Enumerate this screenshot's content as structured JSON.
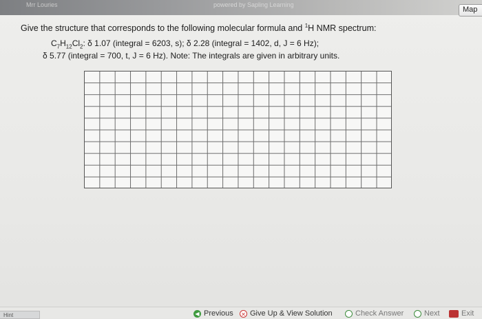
{
  "topbar": {
    "left_text": "Mrr Louries",
    "powered": "powered by Sapling Learning",
    "map_label": "Map"
  },
  "question": {
    "prompt_main": "Give the structure that corresponds to the following molecular formula and ",
    "prompt_sup": "1",
    "prompt_end": "H NMR spectrum:",
    "formula": "C7H12Cl2",
    "line1_rest": ": δ 1.07 (integral = 6203, s); δ 2.28 (integral = 1402, d, J = 6 Hz);",
    "line2": "δ 5.77 (integral = 700, t, J = 6 Hz). Note: The integrals are given in arbitrary units."
  },
  "drawing_grid": {
    "columns": 20,
    "rows": 10
  },
  "buttons": {
    "hint": "Hint",
    "previous": "Previous",
    "give_up": "Give Up & View Solution",
    "check": "Check Answer",
    "next": "Next",
    "exit": "Exit"
  }
}
